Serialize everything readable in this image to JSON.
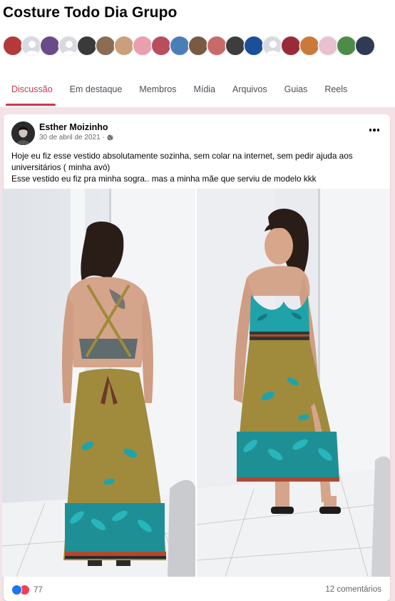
{
  "group": {
    "title": "Costure Todo Dia Grupo",
    "member_avatar_colors": [
      "#b33a3a",
      "#d8dadf",
      "#6a4b8a",
      "#d8dadf",
      "#3a3a3a",
      "#8a6d52",
      "#c9a07a",
      "#e8a0b0",
      "#b84d5e",
      "#4a7fb5",
      "#7a5a45",
      "#c86a6a",
      "#3d3d3d",
      "#1a4f9a",
      "#d8dadf",
      "#9a2a3a",
      "#c97a3a",
      "#e8c0cf",
      "#4e8a4a",
      "#2f3a55"
    ]
  },
  "tabs": [
    {
      "label": "Discussão",
      "active": true
    },
    {
      "label": "Em destaque",
      "active": false
    },
    {
      "label": "Membros",
      "active": false
    },
    {
      "label": "Mídia",
      "active": false
    },
    {
      "label": "Arquivos",
      "active": false
    },
    {
      "label": "Guias",
      "active": false
    },
    {
      "label": "Reels",
      "active": false
    }
  ],
  "post": {
    "author": "Esther Moizinho",
    "date": "30 de abril de 2021",
    "separator": "·",
    "privacy_icon": "globe-icon",
    "more_icon": "more-dots-icon",
    "text_line1": "Hoje eu fiz esse vestido absolutamente sozinha, sem colar na internet, sem pedir ajuda aos",
    "text_line2": "universitários ( minha avó)",
    "text_line3": "Esse vestido eu fiz pra minha sogra.. mas a minha mãe que serviu de modelo kkk",
    "reaction_icons": [
      "like-icon",
      "love-icon"
    ],
    "reaction_count": "77",
    "comments": "12 comentários"
  },
  "colors": {
    "accent": "#c63a52",
    "feed_background": "#f3e3e6",
    "dress_base": "#a08a3c",
    "dress_pattern": "#1fa3a8"
  }
}
